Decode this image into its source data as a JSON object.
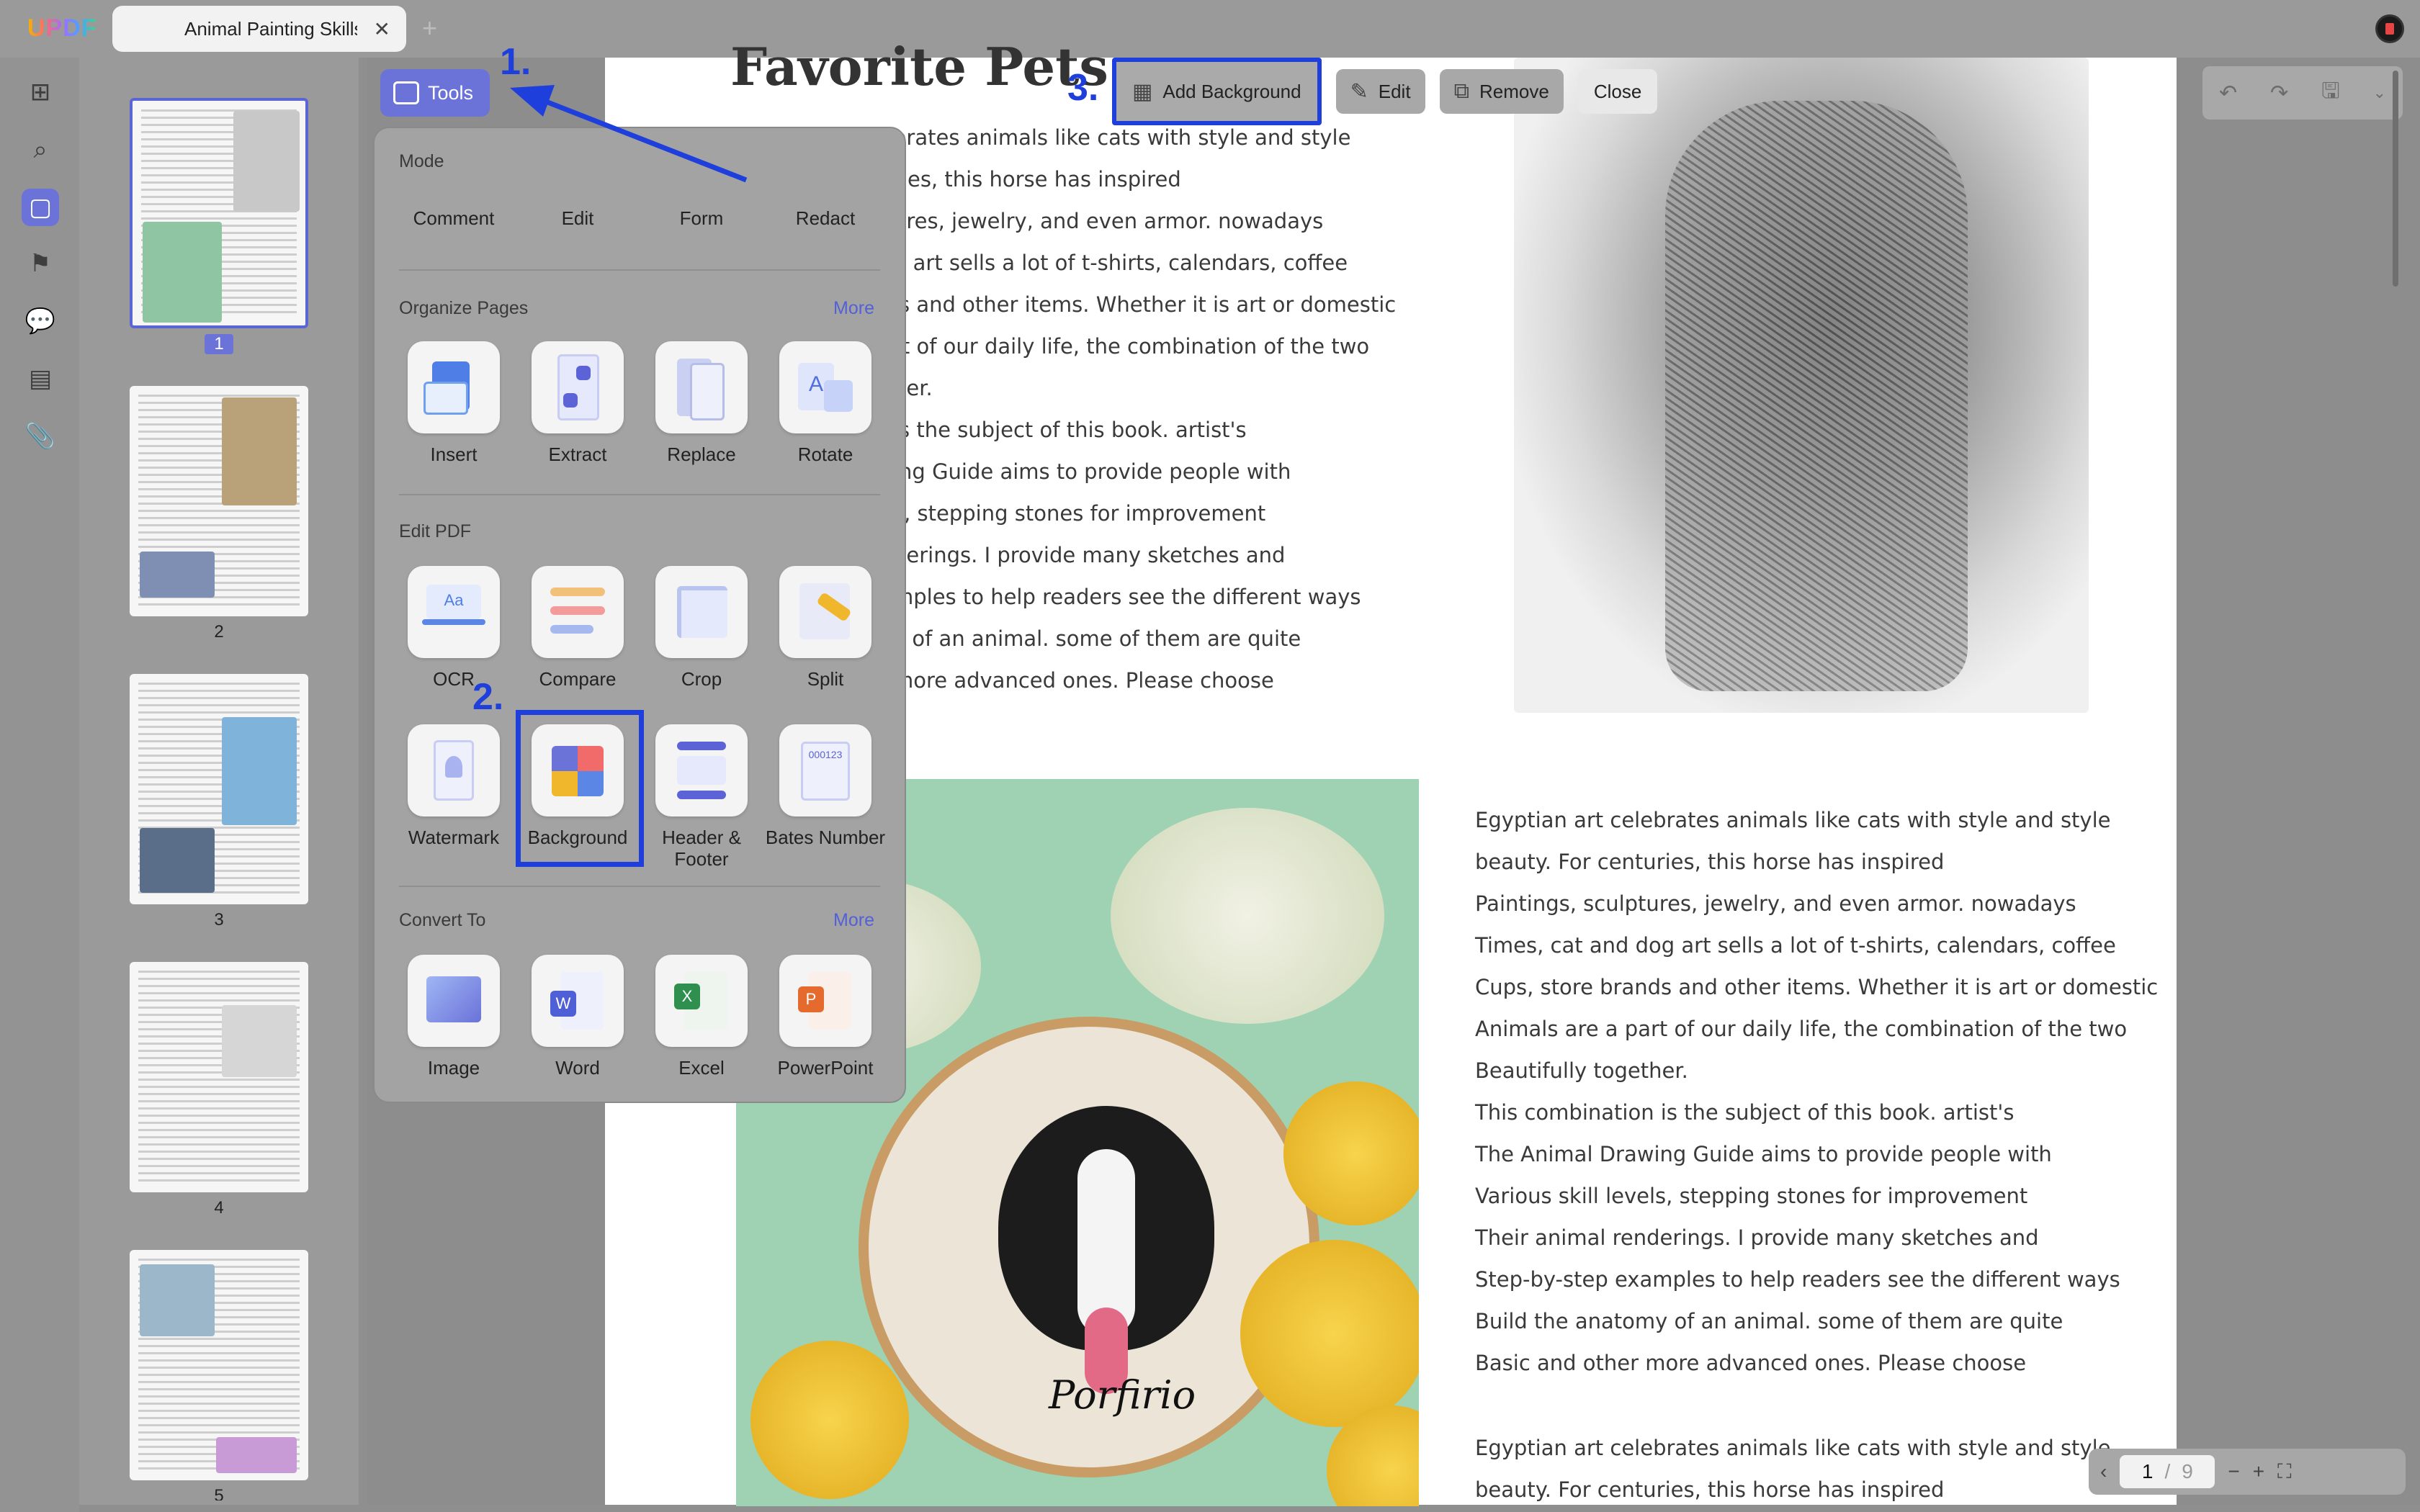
{
  "app": {
    "logo": "UPDF",
    "tab_title": "Animal Painting Skills",
    "tab_close": "✕",
    "tab_add": "+"
  },
  "toolbar": {
    "tools_label": "Tools",
    "add_background": "Add Background",
    "edit": "Edit",
    "remove": "Remove",
    "close": "Close"
  },
  "annotations": {
    "step1": "1.",
    "step2": "2.",
    "step3": "3."
  },
  "popover": {
    "mode_title": "Mode",
    "modes": [
      "Comment",
      "Edit",
      "Form",
      "Redact"
    ],
    "organize_title": "Organize Pages",
    "organize_more": "More",
    "organize": [
      "Insert",
      "Extract",
      "Replace",
      "Rotate"
    ],
    "edit_title": "Edit PDF",
    "edit": [
      "OCR",
      "Compare",
      "Crop",
      "Split",
      "Watermark",
      "Background",
      "Header & Footer",
      "Bates Number"
    ],
    "convert_title": "Convert To",
    "convert_more": "More",
    "convert": [
      "Image",
      "Word",
      "Excel",
      "PowerPoint"
    ]
  },
  "thumbnails": {
    "pages": [
      "1",
      "2",
      "3",
      "4",
      "5"
    ]
  },
  "document": {
    "heading": "Favorite Pets",
    "col1": [
      "brates animals like cats with style and style",
      "ries, this horse has inspired",
      "ures, jewelry, and even armor. nowadays",
      "g art sells a lot of t-shirts, calendars, coffee",
      "ls and other items. Whether it is art or domestic",
      "rt of our daily life, the combination of the two",
      "her.",
      "is the subject of this book. artist's",
      "ing Guide aims to provide people with",
      "s, stepping stones for improvement",
      "derings. I provide many sketches and",
      "mples to help readers see the different ways",
      "y of an animal. some of them are quite",
      "more advanced ones. Please choose"
    ],
    "col2": [
      "Egyptian art celebrates animals like cats with style and style",
      "beauty. For centuries, this horse has inspired",
      "Paintings, sculptures, jewelry, and even armor. nowadays",
      "Times, cat and dog art sells a lot of t-shirts, calendars, coffee",
      "Cups, store brands and other items. Whether it is art or domestic",
      "Animals are a part of our daily life, the combination of the two",
      "Beautifully together.",
      "This combination is the subject of this book. artist's",
      "The Animal Drawing Guide aims to provide people with",
      "Various skill levels, stepping stones for improvement",
      "Their animal renderings. I provide many sketches and",
      "Step-by-step examples to help readers see the different ways",
      "Build the anatomy of an animal. some of them are quite",
      "Basic and other more advanced ones. Please choose"
    ],
    "col3": [
      "Egyptian art celebrates animals like cats with style and style",
      "beauty. For centuries, this horse has inspired"
    ],
    "embroidery_text": "Porfirio"
  },
  "pager": {
    "current": "1",
    "sep": "/",
    "total": "9",
    "zoom_out": "−",
    "zoom_in": "+"
  },
  "colors": {
    "accent": "#6b72d8",
    "highlight": "#1f3fdc"
  }
}
